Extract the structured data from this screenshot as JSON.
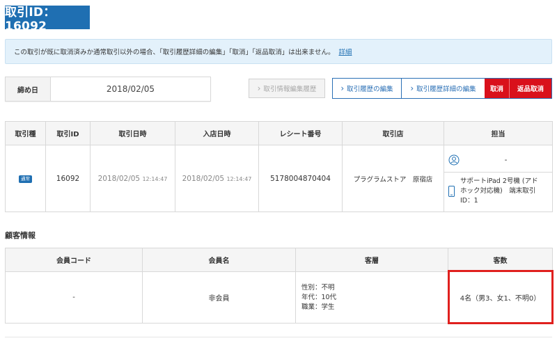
{
  "page_title": "取引ID：16092",
  "notice": {
    "text": "この取引が既に取消済みか通常取引以外の場合、「取引履歴詳細の編集」「取消」「返品取消」は出来ません。",
    "link_label": "詳細"
  },
  "closing_date": {
    "label": "締め日",
    "value": "2018/02/05"
  },
  "buttons": {
    "history_label": "取引情報編集履歴",
    "edit_label": "取引履歴の編集",
    "edit_detail_label": "取引履歴詳細の編集",
    "cancel_label": "取消",
    "return_cancel_label": "返品取消"
  },
  "transaction_table": {
    "headers": [
      "取引種",
      "取引ID",
      "取引日時",
      "入店日時",
      "レシート番号",
      "取引店",
      "担当"
    ],
    "row": {
      "type_badge": "通常",
      "id": "16092",
      "tx_date": "2018/02/05",
      "tx_time": "12:14:47",
      "entry_date": "2018/02/05",
      "entry_time": "12:14:47",
      "receipt_no": "5178004870404",
      "store": "プラグラムストア　原宿店",
      "staff": "-",
      "terminal_line1": "サポートiPad 2号機 (アド",
      "terminal_line2": "ホック対応機)　端末取引",
      "terminal_line3": "ID：1"
    }
  },
  "customer_section": {
    "heading": "顧客情報",
    "headers": [
      "会員コード",
      "会員名",
      "客層",
      "客数"
    ],
    "row": {
      "member_code": "-",
      "member_name": "非会員",
      "gender": "性別：不明",
      "age": "年代：10代",
      "occupation": "職業：学生",
      "count": "4名（男3、女1、不明0）"
    }
  },
  "colors": {
    "primary": "#1f6fb2",
    "danger": "#d9101b",
    "notice_bg": "#e3f1fb",
    "highlight": "#e0201e"
  }
}
